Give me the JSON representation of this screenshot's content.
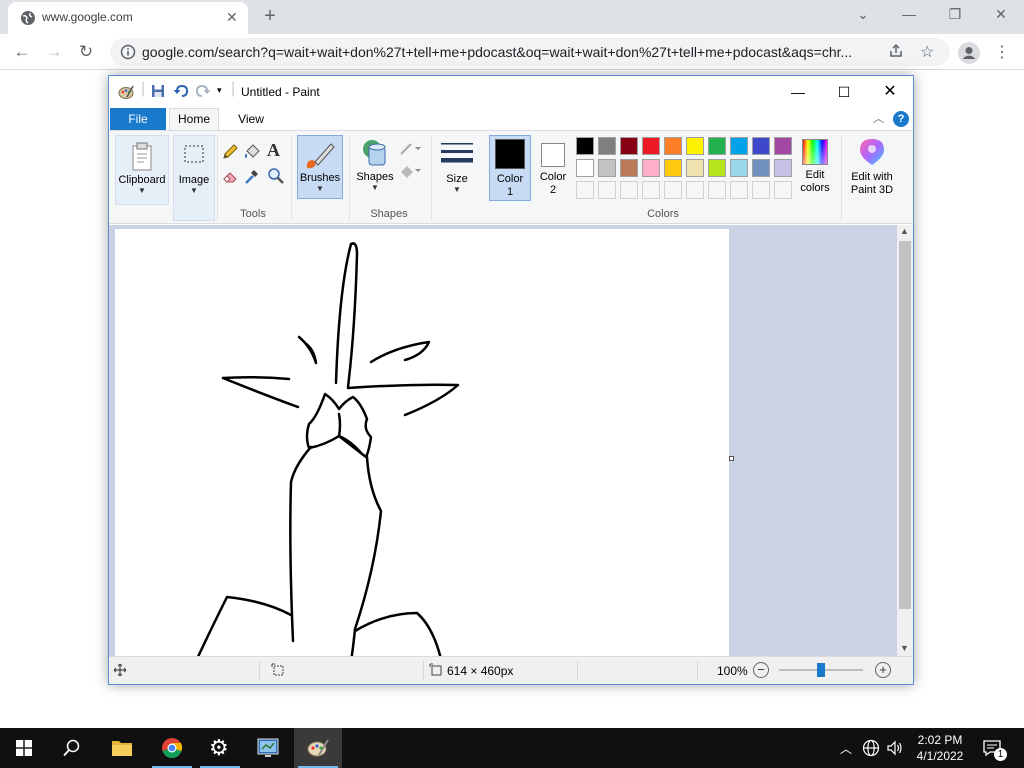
{
  "browser": {
    "tab_title": "www.google.com",
    "url": "google.com/search?q=wait+wait+don%27t+tell+me+pdocast&oq=wait+wait+don%27t+tell+me+pdocast&aqs=chr..."
  },
  "paint": {
    "title": "Untitled - Paint",
    "tabs": {
      "file": "File",
      "home": "Home",
      "view": "View"
    },
    "ribbon": {
      "clipboard": "Clipboard",
      "image": "Image",
      "tools_group": "Tools",
      "brushes": "Brushes",
      "shapes": "Shapes",
      "shapes_group": "Shapes",
      "size": "Size",
      "color1_line1": "Color",
      "color1_line2": "1",
      "color2_line1": "Color",
      "color2_line2": "2",
      "colors_group": "Colors",
      "edit_colors_line1": "Edit",
      "edit_colors_line2": "colors",
      "paint3d_line1": "Edit with",
      "paint3d_line2": "Paint 3D"
    },
    "palette_row1": [
      "#000000",
      "#7f7f7f",
      "#880015",
      "#ed1c24",
      "#ff7f27",
      "#fff200",
      "#22b14c",
      "#00a2e8",
      "#3f48cc",
      "#a349a4"
    ],
    "palette_row2": [
      "#ffffff",
      "#c3c3c3",
      "#b97a57",
      "#ffaec9",
      "#ffc90e",
      "#efe4b0",
      "#b5e61d",
      "#99d9ea",
      "#7092be",
      "#c8bfe7"
    ],
    "color1": "#000000",
    "color2": "#ffffff",
    "status": {
      "dimensions": "614 × 460px",
      "zoom": "100%"
    }
  },
  "taskbar": {
    "time": "2:02 PM",
    "date": "4/1/2022",
    "notifications": "1"
  }
}
